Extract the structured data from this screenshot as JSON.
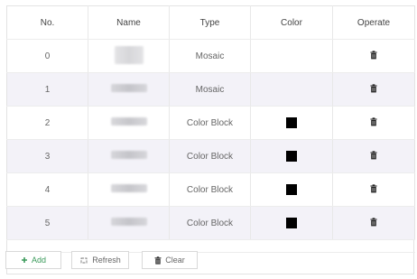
{
  "table": {
    "headers": [
      "No.",
      "Name",
      "Type",
      "Color",
      "Operate"
    ],
    "rows": [
      {
        "no": "0",
        "type": "Mosaic",
        "color": ""
      },
      {
        "no": "1",
        "type": "Mosaic",
        "color": ""
      },
      {
        "no": "2",
        "type": "Color Block",
        "color": "#000000"
      },
      {
        "no": "3",
        "type": "Color Block",
        "color": "#000000"
      },
      {
        "no": "4",
        "type": "Color Block",
        "color": "#000000"
      },
      {
        "no": "5",
        "type": "Color Block",
        "color": "#000000"
      }
    ]
  },
  "toolbar": {
    "add_label": "Add",
    "refresh_label": "Refresh",
    "clear_label": "Clear"
  },
  "icons": {
    "add": "plus-icon",
    "refresh": "refresh-icon",
    "clear": "trash-icon",
    "row_delete": "trash-icon"
  },
  "colors": {
    "accent": "#3a9a5a",
    "stripe": "#f3f2f8"
  }
}
